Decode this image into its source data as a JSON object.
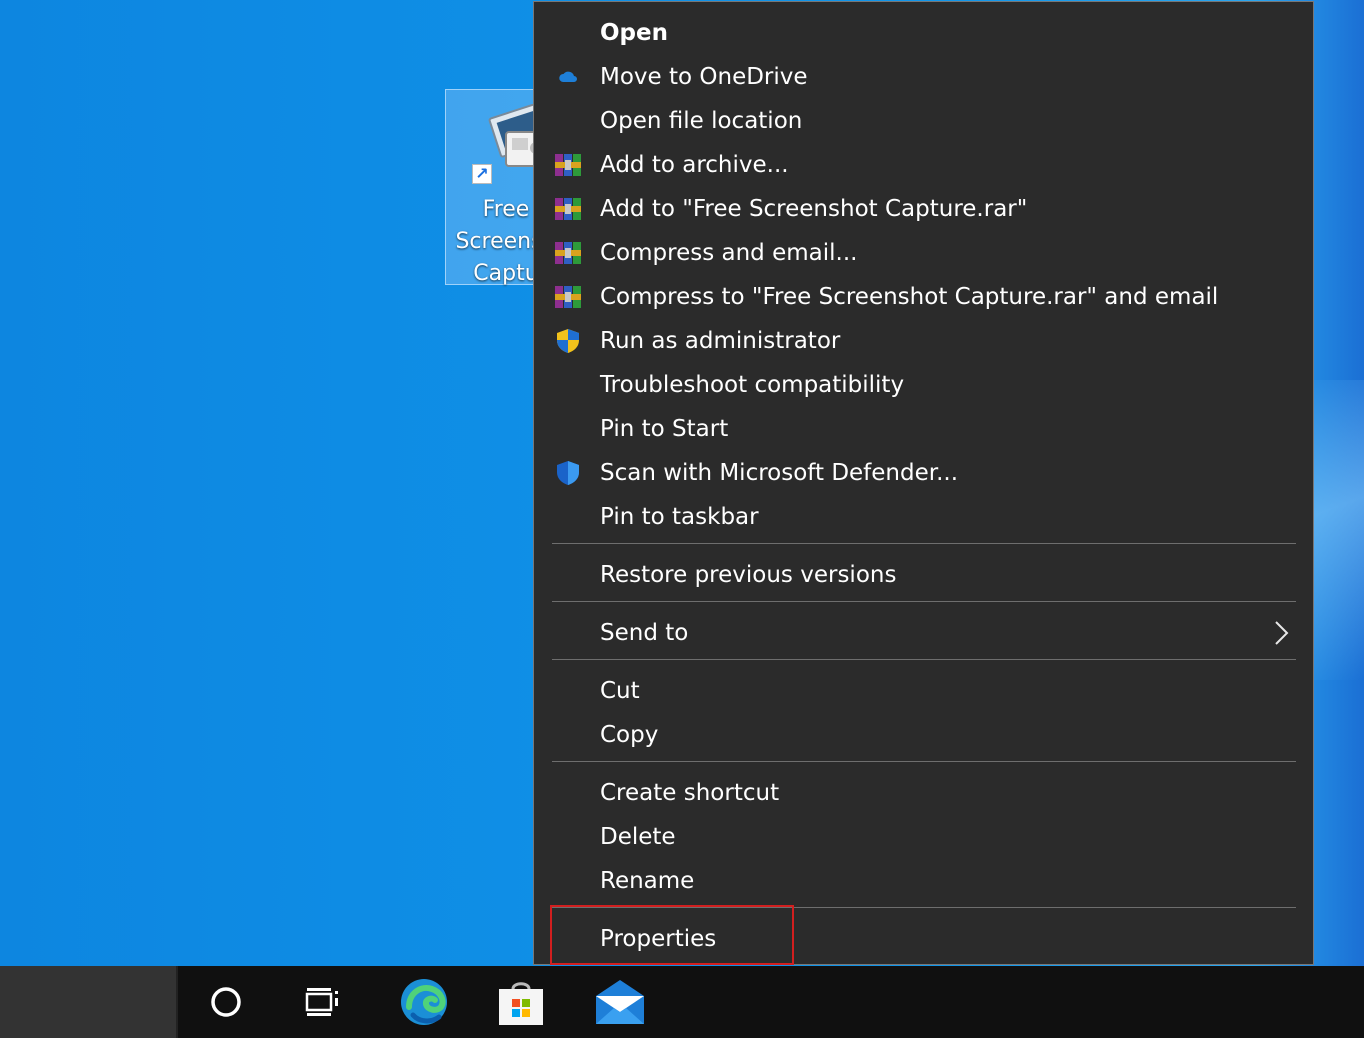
{
  "desktop": {
    "icon_label": "Free\nScreensh\nCaptu",
    "shortcut_glyph": "↗"
  },
  "context_menu": {
    "items": [
      {
        "label": "Open",
        "icon": "none"
      },
      {
        "label": "Move to OneDrive",
        "icon": "onedrive-icon"
      },
      {
        "label": "Open file location",
        "icon": "none"
      },
      {
        "label": "Add to archive...",
        "icon": "winrar-icon"
      },
      {
        "label": "Add to \"Free Screenshot Capture.rar\"",
        "icon": "winrar-icon"
      },
      {
        "label": "Compress and email...",
        "icon": "winrar-icon"
      },
      {
        "label": "Compress to \"Free Screenshot Capture.rar\" and email",
        "icon": "winrar-icon"
      },
      {
        "label": "Run as administrator",
        "icon": "uac-shield-icon"
      },
      {
        "label": "Troubleshoot compatibility",
        "icon": "none"
      },
      {
        "label": "Pin to Start",
        "icon": "none"
      },
      {
        "label": "Scan with Microsoft Defender...",
        "icon": "defender-shield-icon"
      },
      {
        "label": "Pin to taskbar",
        "icon": "none"
      },
      {
        "label": "Restore previous versions",
        "icon": "none"
      },
      {
        "label": "Send to",
        "icon": "none",
        "submenu": true
      },
      {
        "label": "Cut",
        "icon": "none"
      },
      {
        "label": "Copy",
        "icon": "none"
      },
      {
        "label": "Create shortcut",
        "icon": "none"
      },
      {
        "label": "Delete",
        "icon": "none"
      },
      {
        "label": "Rename",
        "icon": "none"
      },
      {
        "label": "Properties",
        "icon": "none",
        "highlighted": true
      }
    ]
  },
  "taskbar": {
    "buttons": [
      "cortana-icon",
      "task-view-icon",
      "edge-icon",
      "store-icon",
      "mail-icon"
    ]
  },
  "colors": {
    "menu_bg": "#2b2b2b",
    "highlight": "#d21f1f",
    "desktop": "#0f8fe6"
  }
}
